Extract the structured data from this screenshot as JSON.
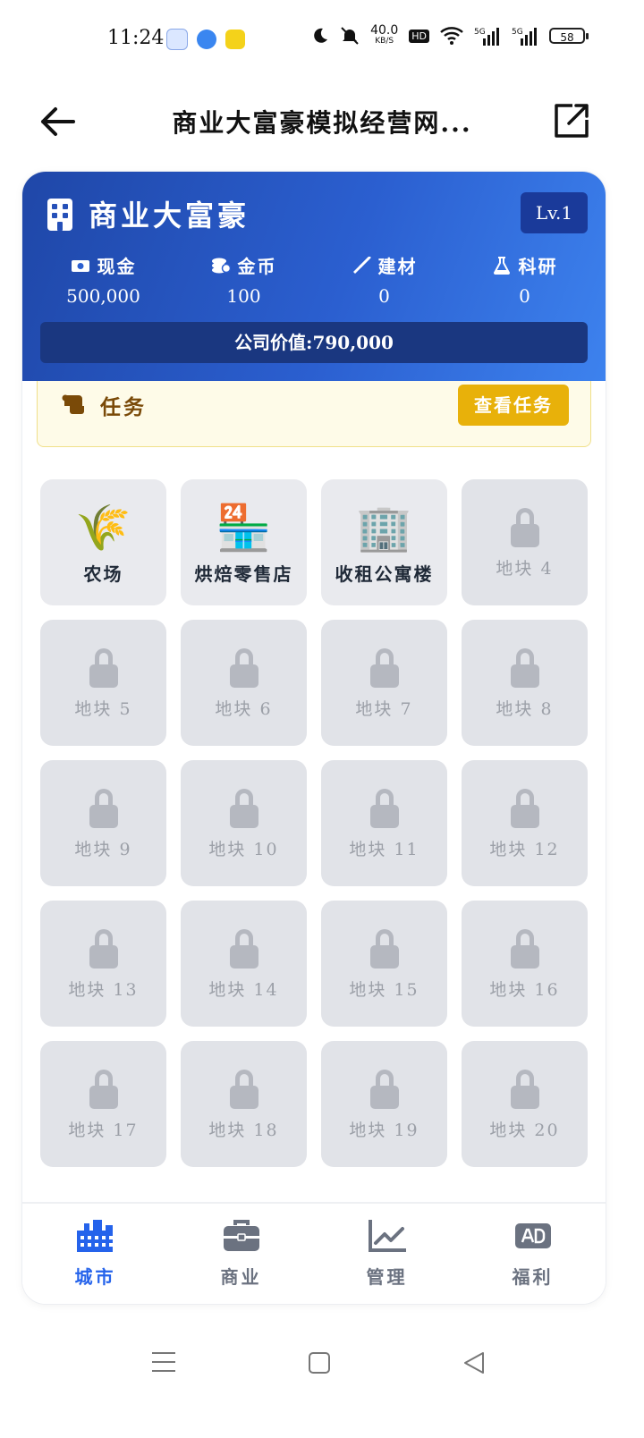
{
  "status_bar": {
    "time": "11:24",
    "net_speed": "40.0",
    "net_unit": "KB/S",
    "battery": "58"
  },
  "header": {
    "title": "商业大富豪模拟经营网..."
  },
  "hero": {
    "title": "商业大富豪",
    "level": "Lv.1",
    "stats": [
      {
        "label": "现金",
        "value": "500,000",
        "icon": "cash-icon"
      },
      {
        "label": "金币",
        "value": "100",
        "icon": "coins-icon"
      },
      {
        "label": "建材",
        "value": "0",
        "icon": "trowel-icon"
      },
      {
        "label": "科研",
        "value": "0",
        "icon": "flask-icon"
      }
    ],
    "company_label": "公司价值:",
    "company_value": "790,000"
  },
  "task": {
    "label": "任务",
    "button": "查看任务"
  },
  "tiles": [
    {
      "name": "农场",
      "emoji": "🌾",
      "locked": false
    },
    {
      "name": "烘焙零售店",
      "emoji": "🏪",
      "locked": false
    },
    {
      "name": "收租公寓楼",
      "emoji": "🏢",
      "locked": false
    },
    {
      "name": "地块 4",
      "locked": true
    },
    {
      "name": "地块 5",
      "locked": true
    },
    {
      "name": "地块 6",
      "locked": true
    },
    {
      "name": "地块 7",
      "locked": true
    },
    {
      "name": "地块 8",
      "locked": true
    },
    {
      "name": "地块 9",
      "locked": true
    },
    {
      "name": "地块 10",
      "locked": true
    },
    {
      "name": "地块 11",
      "locked": true
    },
    {
      "name": "地块 12",
      "locked": true
    },
    {
      "name": "地块 13",
      "locked": true
    },
    {
      "name": "地块 14",
      "locked": true
    },
    {
      "name": "地块 15",
      "locked": true
    },
    {
      "name": "地块 16",
      "locked": true
    },
    {
      "name": "地块 17",
      "locked": true
    },
    {
      "name": "地块 18",
      "locked": true
    },
    {
      "name": "地块 19",
      "locked": true
    },
    {
      "name": "地块 20",
      "locked": true
    }
  ],
  "nav": [
    {
      "label": "城市",
      "icon": "city-icon",
      "active": true
    },
    {
      "label": "商业",
      "icon": "briefcase-icon",
      "active": false
    },
    {
      "label": "管理",
      "icon": "chart-line-icon",
      "active": false
    },
    {
      "label": "福利",
      "icon": "ad-icon",
      "active": false
    }
  ],
  "colors": {
    "primary": "#2563eb",
    "hero_dark": "#1f47a8",
    "task_button": "#e8b10a",
    "task_text": "#7a4a08"
  }
}
